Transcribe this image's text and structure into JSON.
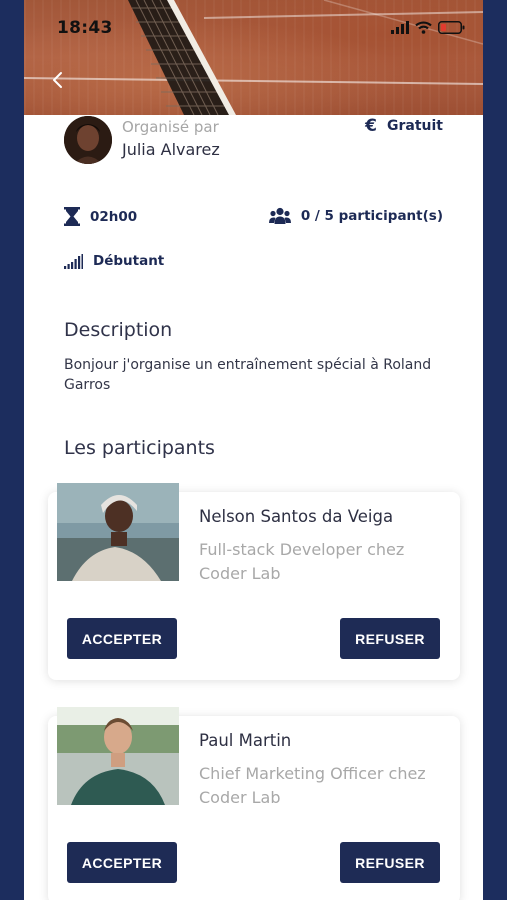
{
  "status_bar": {
    "time": "18:43"
  },
  "organizer": {
    "label": "Organisé par",
    "name": "Julia Alvarez"
  },
  "price": {
    "icon": "€",
    "label": "Gratuit"
  },
  "info": {
    "duration": "02h00",
    "participants": "0 / 5 participant(s)",
    "level": "Débutant"
  },
  "description": {
    "title": "Description",
    "text": "Bonjour j'organise un entraînement spécial à Roland Garros"
  },
  "participants": {
    "title": "Les participants",
    "items": [
      {
        "name": "Nelson Santos da Veiga",
        "role": "Full-stack Developer chez Coder Lab",
        "accept": "ACCEPTER",
        "refuse": "REFUSER"
      },
      {
        "name": "Paul Martin",
        "role": "Chief Marketing Officer chez Coder Lab",
        "accept": "ACCEPTER",
        "refuse": "REFUSER"
      }
    ]
  },
  "colors": {
    "navy": "#1e2b55",
    "frame": "#1c2d5e",
    "clay": "#a85a3c"
  }
}
